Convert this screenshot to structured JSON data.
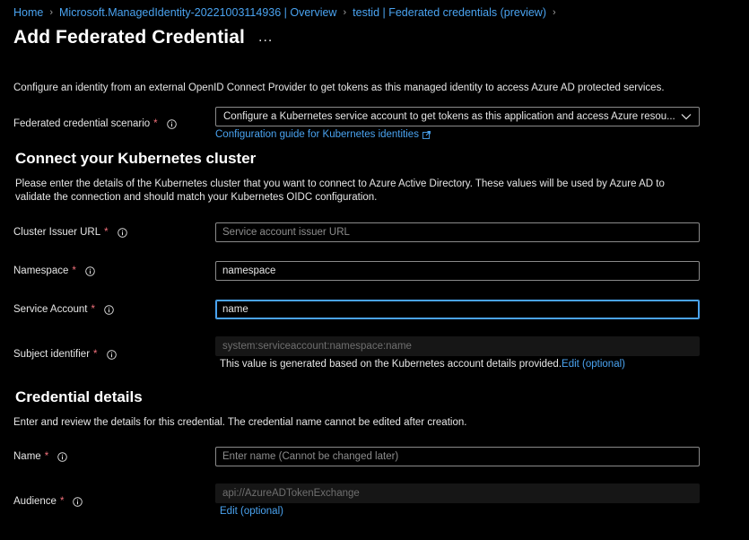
{
  "breadcrumb": [
    {
      "label": "Home"
    },
    {
      "label": "Microsoft.ManagedIdentity-20221003114936 | Overview"
    },
    {
      "label": "testid | Federated credentials (preview)"
    }
  ],
  "page": {
    "title": "Add Federated Credential",
    "more": "...",
    "intro": "Configure an identity from an external OpenID Connect Provider to get tokens as this managed identity to access Azure AD protected services."
  },
  "scenario": {
    "label": "Federated credential scenario",
    "required": "*",
    "value": "Configure a Kubernetes service account to get tokens as this application and access Azure resou...",
    "guide_link": "Configuration guide for Kubernetes identities"
  },
  "cluster": {
    "heading": "Connect your Kubernetes cluster",
    "description": "Please enter the details of the Kubernetes cluster that you want to connect to Azure Active Directory. These values will be used by Azure AD to validate the connection and should match your Kubernetes OIDC configuration.",
    "issuer": {
      "label": "Cluster Issuer URL",
      "required": "*",
      "value": "",
      "placeholder": "Service account issuer URL"
    },
    "namespace": {
      "label": "Namespace",
      "required": "*",
      "value": "namespace",
      "placeholder": ""
    },
    "service_account": {
      "label": "Service Account",
      "required": "*",
      "value": "name",
      "placeholder": ""
    },
    "subject": {
      "label": "Subject identifier",
      "required": "*",
      "value": "system:serviceaccount:namespace:name",
      "helper": "This value is generated based on the Kubernetes account details provided.",
      "edit_link": "Edit (optional)"
    }
  },
  "credential": {
    "heading": "Credential details",
    "description": "Enter and review the details for this credential. The credential name cannot be edited after creation.",
    "name": {
      "label": "Name",
      "required": "*",
      "value": "",
      "placeholder": "Enter name (Cannot be changed later)"
    },
    "audience": {
      "label": "Audience",
      "required": "*",
      "value": "api://AzureADTokenExchange",
      "edit_link": "Edit (optional)"
    }
  },
  "colors": {
    "accent": "#4aa3f0",
    "required": "#f1707b",
    "background": "#000000"
  }
}
